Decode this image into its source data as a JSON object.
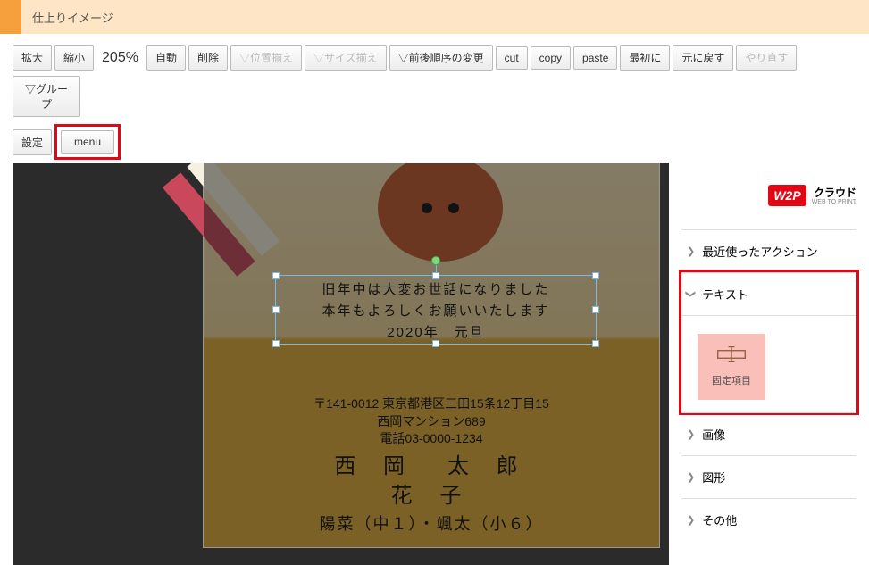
{
  "accent_orange": "#f59f3d",
  "highlight_red": "#e30613",
  "title": "仕上りイメージ",
  "toolbar": {
    "zoom_in": "拡大",
    "zoom_out": "縮小",
    "zoom_value": "205%",
    "auto": "自動",
    "delete": "削除",
    "align_pos": "▽位置揃え",
    "align_size": "▽サイズ揃え",
    "order": "▽前後順序の変更",
    "cut": "cut",
    "copy": "copy",
    "paste": "paste",
    "first": "最初に",
    "undo": "元に戻す",
    "redo": "やり直す",
    "group": "▽グループ"
  },
  "second_row": {
    "settings": "設定",
    "menu": "menu"
  },
  "card": {
    "line1": "旧年中は大変お世話になりました",
    "line2": "本年もよろしくお願いいたします",
    "line3": "2020年　元旦",
    "addr1": "〒141-0012 東京都港区三田15条12丁目15",
    "addr2": "西岡マンション689",
    "addr3": "電話03-0000-1234",
    "name1": "西 岡　太 郎",
    "name2": "花 子",
    "family": "陽菜（中１）・颯太（小６）"
  },
  "brand": {
    "logo": "W2P",
    "cloud": "クラウド",
    "sub": "WEB TO PRINT"
  },
  "sidebar": {
    "recent": "最近使ったアクション",
    "text": "テキスト",
    "tile_label": "固定項目",
    "image": "画像",
    "shape": "図形",
    "other": "その他"
  }
}
